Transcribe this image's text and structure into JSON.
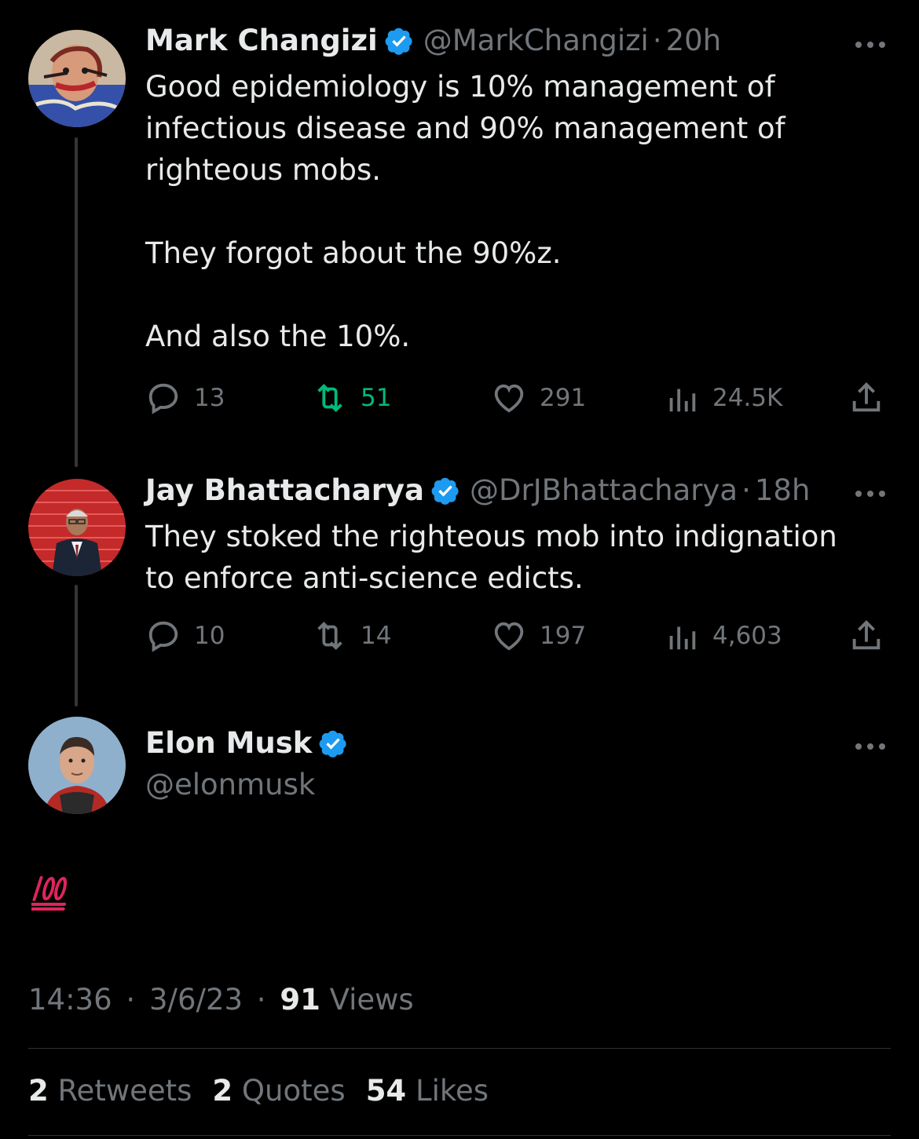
{
  "tweets": [
    {
      "name": "Mark Changizi",
      "handle": "@MarkChangizi",
      "time": "20h",
      "text": "Good epidemiology is 10% management of\ninfectious disease and 90% management of\nrighteous mobs.\n\nThey forgot about the 90%z.\n\nAnd also the 10%.",
      "replies": "13",
      "retweets": "51",
      "likes": "291",
      "views": "24.5K",
      "retweeted": true
    },
    {
      "name": "Jay Bhattacharya",
      "handle": "@DrJBhattacharya",
      "time": "18h",
      "text": "They stoked the righteous mob into indignation\nto enforce anti-science edicts.",
      "replies": "10",
      "retweets": "14",
      "likes": "197",
      "views": "4,603",
      "retweeted": false
    }
  ],
  "main_tweet": {
    "name": "Elon Musk",
    "handle": "@elonmusk",
    "emoji": "hundred-points-emoji",
    "time": "14:36",
    "date": "3/6/23",
    "views_count": "91",
    "views_label": "Views",
    "retweets_count": "2",
    "retweets_label": "Retweets",
    "quotes_count": "2",
    "quotes_label": "Quotes",
    "likes_count": "54",
    "likes_label": "Likes"
  },
  "separator": "·",
  "colors": {
    "background": "#000000",
    "text_primary": "#e7e9ea",
    "text_secondary": "#71767b",
    "verified": "#1d9bf0",
    "retweet_active": "#00ba7c",
    "hundred_emoji": "#e0245e"
  }
}
